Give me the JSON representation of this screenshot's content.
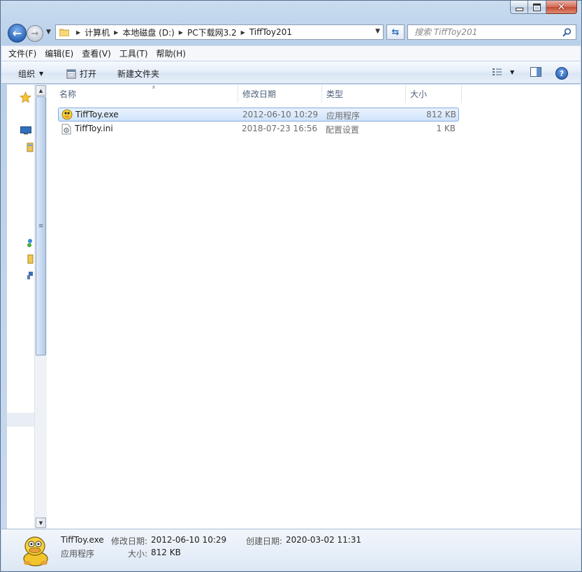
{
  "window": {
    "minimize": "—",
    "maximize": "□",
    "close": "✕"
  },
  "nav": {
    "breadcrumbs": [
      "计算机",
      "本地磁盘 (D:)",
      "PC下载网3.2",
      "TiffToy201"
    ],
    "search_placeholder": "搜索 TiffToy201"
  },
  "menubar": {
    "items": [
      "文件(F)",
      "编辑(E)",
      "查看(V)",
      "工具(T)",
      "帮助(H)"
    ]
  },
  "toolbar": {
    "organize": "组织",
    "open": "打开",
    "new_folder": "新建文件夹",
    "help": "?"
  },
  "columns": [
    "名称",
    "修改日期",
    "类型",
    "大小"
  ],
  "files": [
    {
      "name": "TiffToy.exe",
      "modified": "2012-06-10 10:29",
      "type": "应用程序",
      "size": "812 KB",
      "icon": "application-icon",
      "selected": true
    },
    {
      "name": "TiffToy.ini",
      "modified": "2018-07-23 16:56",
      "type": "配置设置",
      "size": "1 KB",
      "icon": "settings-file-icon",
      "selected": false
    }
  ],
  "details": {
    "name": "TiffToy.exe",
    "type": "应用程序",
    "modified_label": "修改日期:",
    "modified_value": "2012-06-10 10:29",
    "created_label": "创建日期:",
    "created_value": "2020-03-02 11:31",
    "size_label": "大小:",
    "size_value": "812 KB"
  },
  "colors": {
    "selection": "#cfe3fa",
    "selection_border": "#84acdd",
    "frame": "#b9d0ea"
  }
}
